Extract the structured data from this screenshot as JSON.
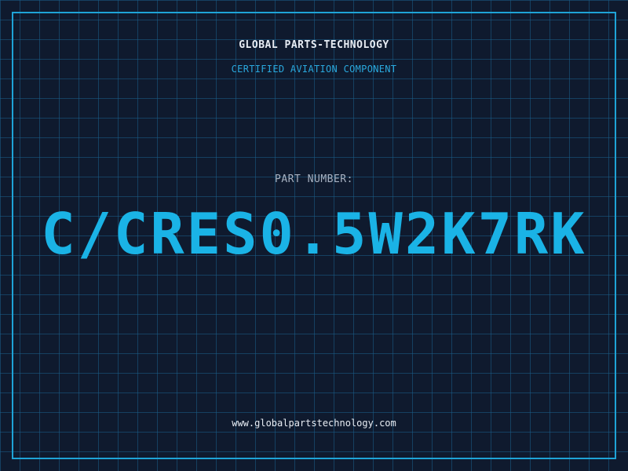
{
  "header": {
    "company": "GLOBAL PARTS-TECHNOLOGY",
    "subtitle": "CERTIFIED AVIATION COMPONENT"
  },
  "part": {
    "label": "PART NUMBER:",
    "number": "C/CRES0.5W2K7RK"
  },
  "footer": {
    "website": "www.globalpartstechnology.com"
  },
  "colors": {
    "background": "#0f1a2e",
    "grid": "#1a5e8a",
    "frame": "#1fa3d6",
    "accent": "#1ab3e6"
  }
}
